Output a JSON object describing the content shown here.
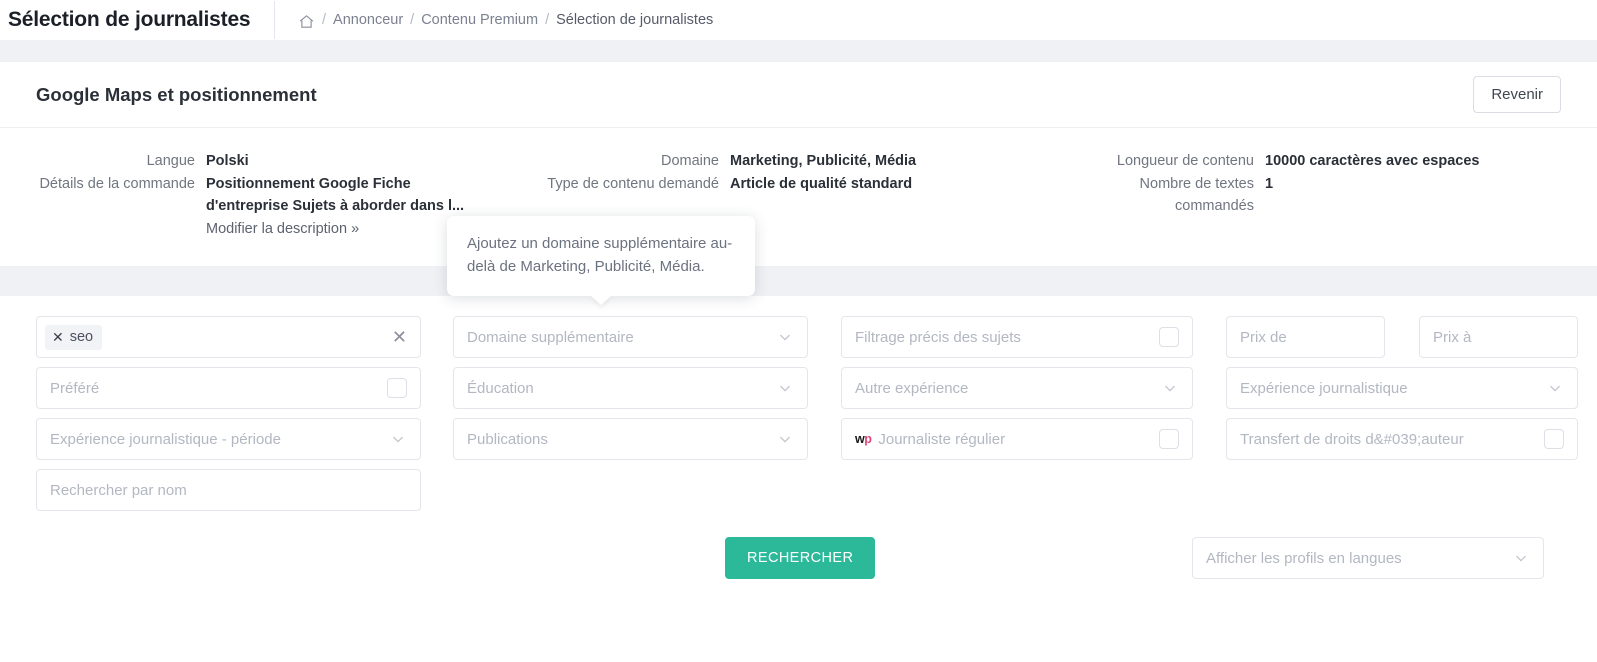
{
  "topbar": {
    "title": "Sélection de journalistes",
    "breadcrumb": {
      "home_icon": "home-icon",
      "sep": "/",
      "items": [
        {
          "label": "Annonceur"
        },
        {
          "label": "Contenu Premium"
        },
        {
          "label": "Sélection de journalistes"
        }
      ]
    }
  },
  "card": {
    "title": "Google Maps et positionnement",
    "back_button": "Revenir"
  },
  "details": {
    "col1": {
      "labels": [
        "Langue",
        "Détails de la commande"
      ],
      "value_language": "Polski",
      "value_order": "Positionnement Google Fiche d'entreprise Sujets à aborder dans l...",
      "edit_link": "Modifier la description »"
    },
    "col2": {
      "labels": [
        "Domaine",
        "Type de contenu demandé"
      ],
      "value_domain": "Marketing, Publicité, Média",
      "value_content_type": "Article de qualité standard"
    },
    "col3": {
      "labels": [
        "Longueur de contenu",
        "Nombre de textes commandés"
      ],
      "value_length": "10000 caractères avec espaces",
      "value_count": "1"
    }
  },
  "tooltip": {
    "text": "Ajoutez un domaine supplémentaire au-delà de Marketing, Publicité, Média."
  },
  "filters": {
    "keywords": {
      "tags": [
        "seo"
      ],
      "tag_remove_icon": "close-icon",
      "clear_icon": "clear-icon"
    },
    "extra_domain": {
      "placeholder": "Domaine supplémentaire",
      "icon": "chevron-down-icon"
    },
    "precise_topics": {
      "placeholder": "Filtrage précis des sujets",
      "icon": "checkbox"
    },
    "price_from": {
      "placeholder": "Prix de"
    },
    "price_to": {
      "placeholder": "Prix à"
    },
    "preferred": {
      "placeholder": "Préféré",
      "icon": "checkbox"
    },
    "education": {
      "placeholder": "Éducation",
      "icon": "chevron-down-icon"
    },
    "other_experience": {
      "placeholder": "Autre expérience",
      "icon": "chevron-down-icon"
    },
    "journalistic_experience": {
      "placeholder": "Expérience journalistique",
      "icon": "chevron-down-icon"
    },
    "journalistic_experience_period": {
      "placeholder": "Expérience journalistique - période",
      "icon": "chevron-down-icon"
    },
    "publications": {
      "placeholder": "Publications",
      "icon": "chevron-down-icon"
    },
    "regular_journalist": {
      "placeholder": "Journaliste régulier",
      "icon": "wp-icon",
      "icon_text_w": "w",
      "icon_text_p": "p"
    },
    "copyright_transfer": {
      "placeholder": "Transfert de droits d&#039;auteur",
      "icon": "checkbox"
    },
    "name_search": {
      "placeholder": "Rechercher par nom"
    },
    "search_button": "RECHERCHER",
    "profile_languages": {
      "placeholder": "Afficher les profils en langues",
      "icon": "chevron-down-icon"
    }
  },
  "colors": {
    "accent": "#2cb99a",
    "band": "#f0f1f5",
    "border": "#e4e6ec",
    "placeholder": "#b3b7c2",
    "wp_pink": "#e0457b"
  }
}
